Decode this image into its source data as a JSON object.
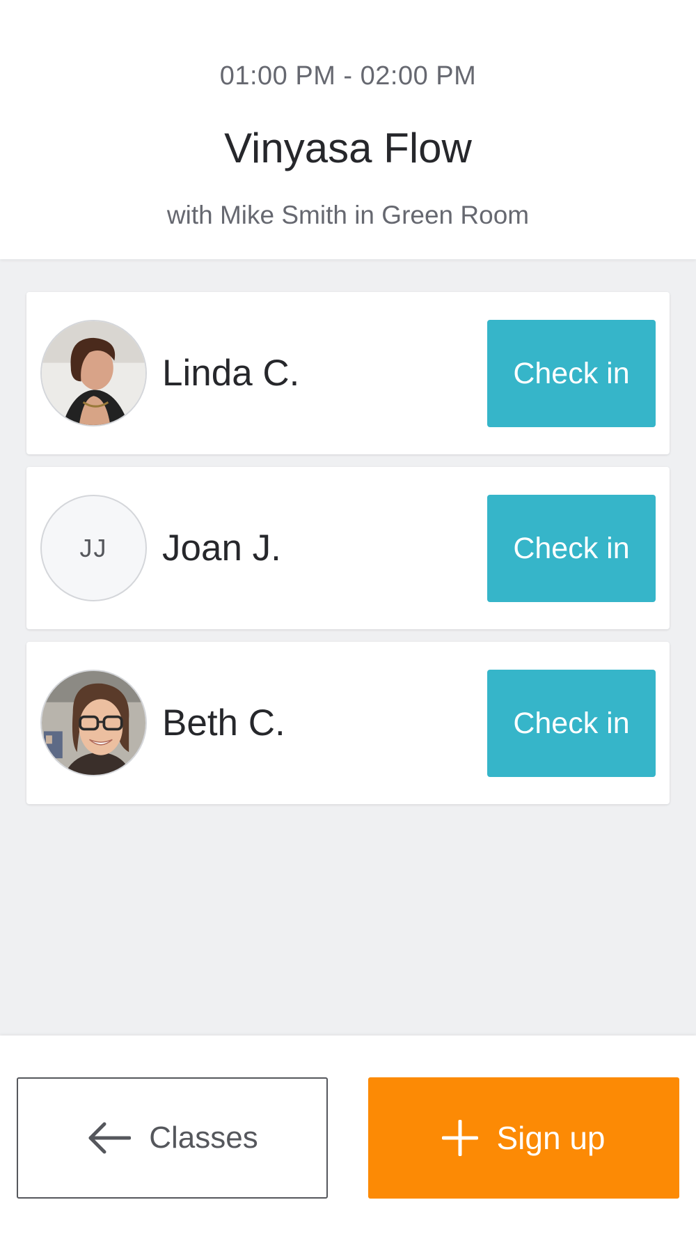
{
  "class_info": {
    "time_range": "01:00 PM - 02:00 PM",
    "title": "Vinyasa Flow",
    "subtitle": "with Mike Smith in Green Room"
  },
  "attendees": [
    {
      "name": "Linda C.",
      "avatar": "photo",
      "action_label": "Check in"
    },
    {
      "name": "Joan J.",
      "avatar": "initials",
      "initials": "JJ",
      "action_label": "Check in"
    },
    {
      "name": "Beth C.",
      "avatar": "photo",
      "action_label": "Check in"
    }
  ],
  "footer": {
    "back_label": "Classes",
    "back_icon": "arrow-left-icon",
    "signup_label": "Sign up",
    "signup_icon": "plus-icon"
  },
  "colors": {
    "checkin_button": "#36b5c9",
    "signup_button": "#fc8a05",
    "background": "#eff0f2"
  }
}
